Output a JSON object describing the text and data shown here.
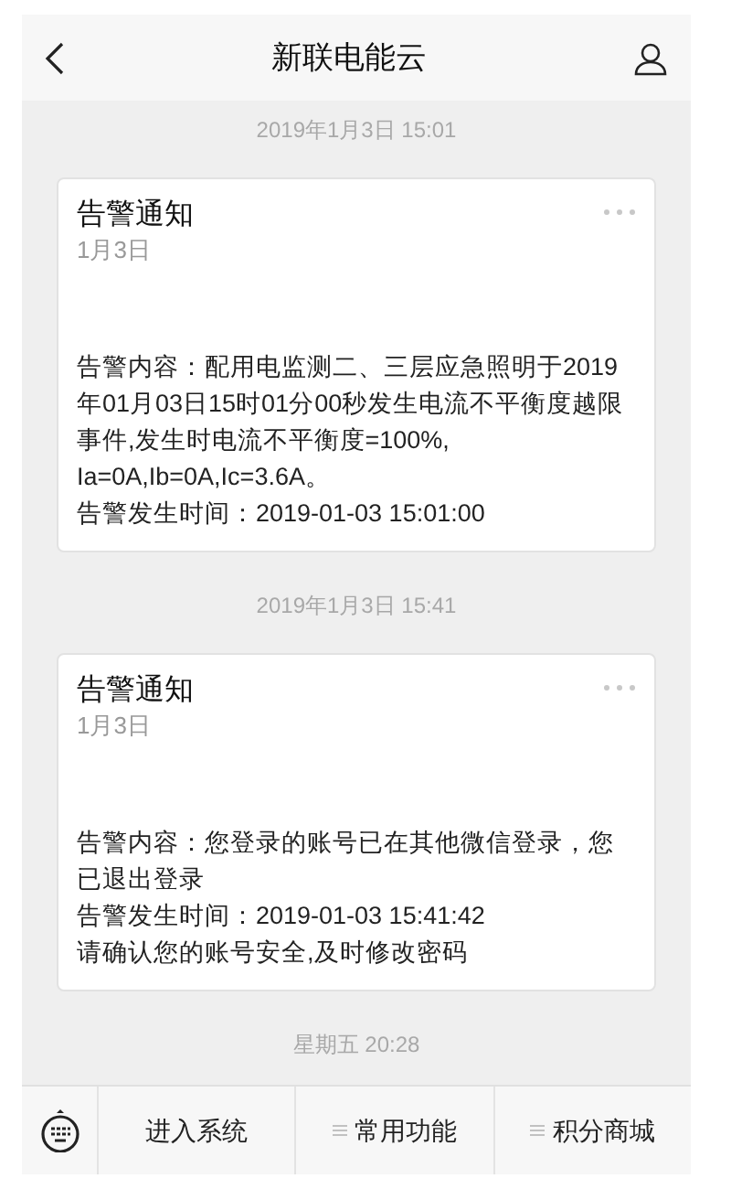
{
  "header": {
    "title": "新联电能云"
  },
  "messages": [
    {
      "timestamp": "2019年1月3日 15:01",
      "card": {
        "title": "告警通知",
        "date": "1月3日",
        "lines": [
          "告警内容：配用电监测二、三层应急照明于2019年01月03日15时01分00秒发生电流不平衡度越限事件,发生时电流不平衡度=100%,",
          "Ia=0A,Ib=0A,Ic=3.6A。",
          "告警发生时间：2019-01-03 15:01:00"
        ]
      }
    },
    {
      "timestamp": "2019年1月3日 15:41",
      "card": {
        "title": "告警通知",
        "date": "1月3日",
        "lines": [
          "告警内容：您登录的账号已在其他微信登录，您已退出登录",
          "告警发生时间：2019-01-03 15:41:42",
          "请确认您的账号安全,及时修改密码"
        ]
      }
    },
    {
      "timestamp": "星期五 20:28"
    }
  ],
  "menu": [
    {
      "label": "进入系统",
      "has_submenu": false
    },
    {
      "label": "常用功能",
      "has_submenu": true
    },
    {
      "label": "积分商城",
      "has_submenu": true
    }
  ]
}
